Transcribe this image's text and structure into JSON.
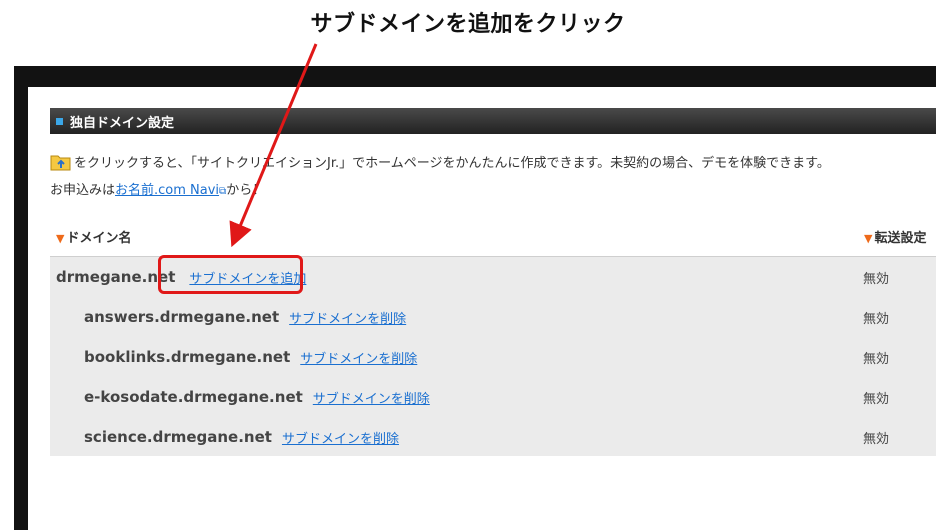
{
  "callout": {
    "text": "サブドメインを追加をクリック",
    "color": "#e01818"
  },
  "section": {
    "title": "独自ドメイン設定",
    "icon": "square-bullet-icon"
  },
  "info": {
    "icon": "folder-up-icon",
    "line1": "をクリックすると、「サイトクリエイションJr.」でホームページをかんたんに作成できます。未契約の場合、デモを体験できます。",
    "line2_prefix": "お申込みは",
    "line2_link": "お名前.com Navi",
    "line2_link_icon": "external-link-icon",
    "line2_suffix": "から！"
  },
  "columns": {
    "domain": "ドメイン名",
    "transfer": "転送設定"
  },
  "rows": [
    {
      "domain": "drmegane.net",
      "action": "サブドメインを追加",
      "status": "無効"
    },
    {
      "domain": "answers.drmegane.net",
      "action": "サブドメインを削除",
      "status": "無効"
    },
    {
      "domain": "booklinks.drmegane.net",
      "action": "サブドメインを削除",
      "status": "無効"
    },
    {
      "domain": "e-kosodate.drmegane.net",
      "action": "サブドメインを削除",
      "status": "無効"
    },
    {
      "domain": "science.drmegane.net",
      "action": "サブドメインを削除",
      "status": "無効"
    }
  ],
  "colors": {
    "header_bg": "#2a2a2a",
    "link": "#1a6fd0",
    "accent_triangle": "#ee6a1a",
    "table_bg": "#ebebeb"
  }
}
